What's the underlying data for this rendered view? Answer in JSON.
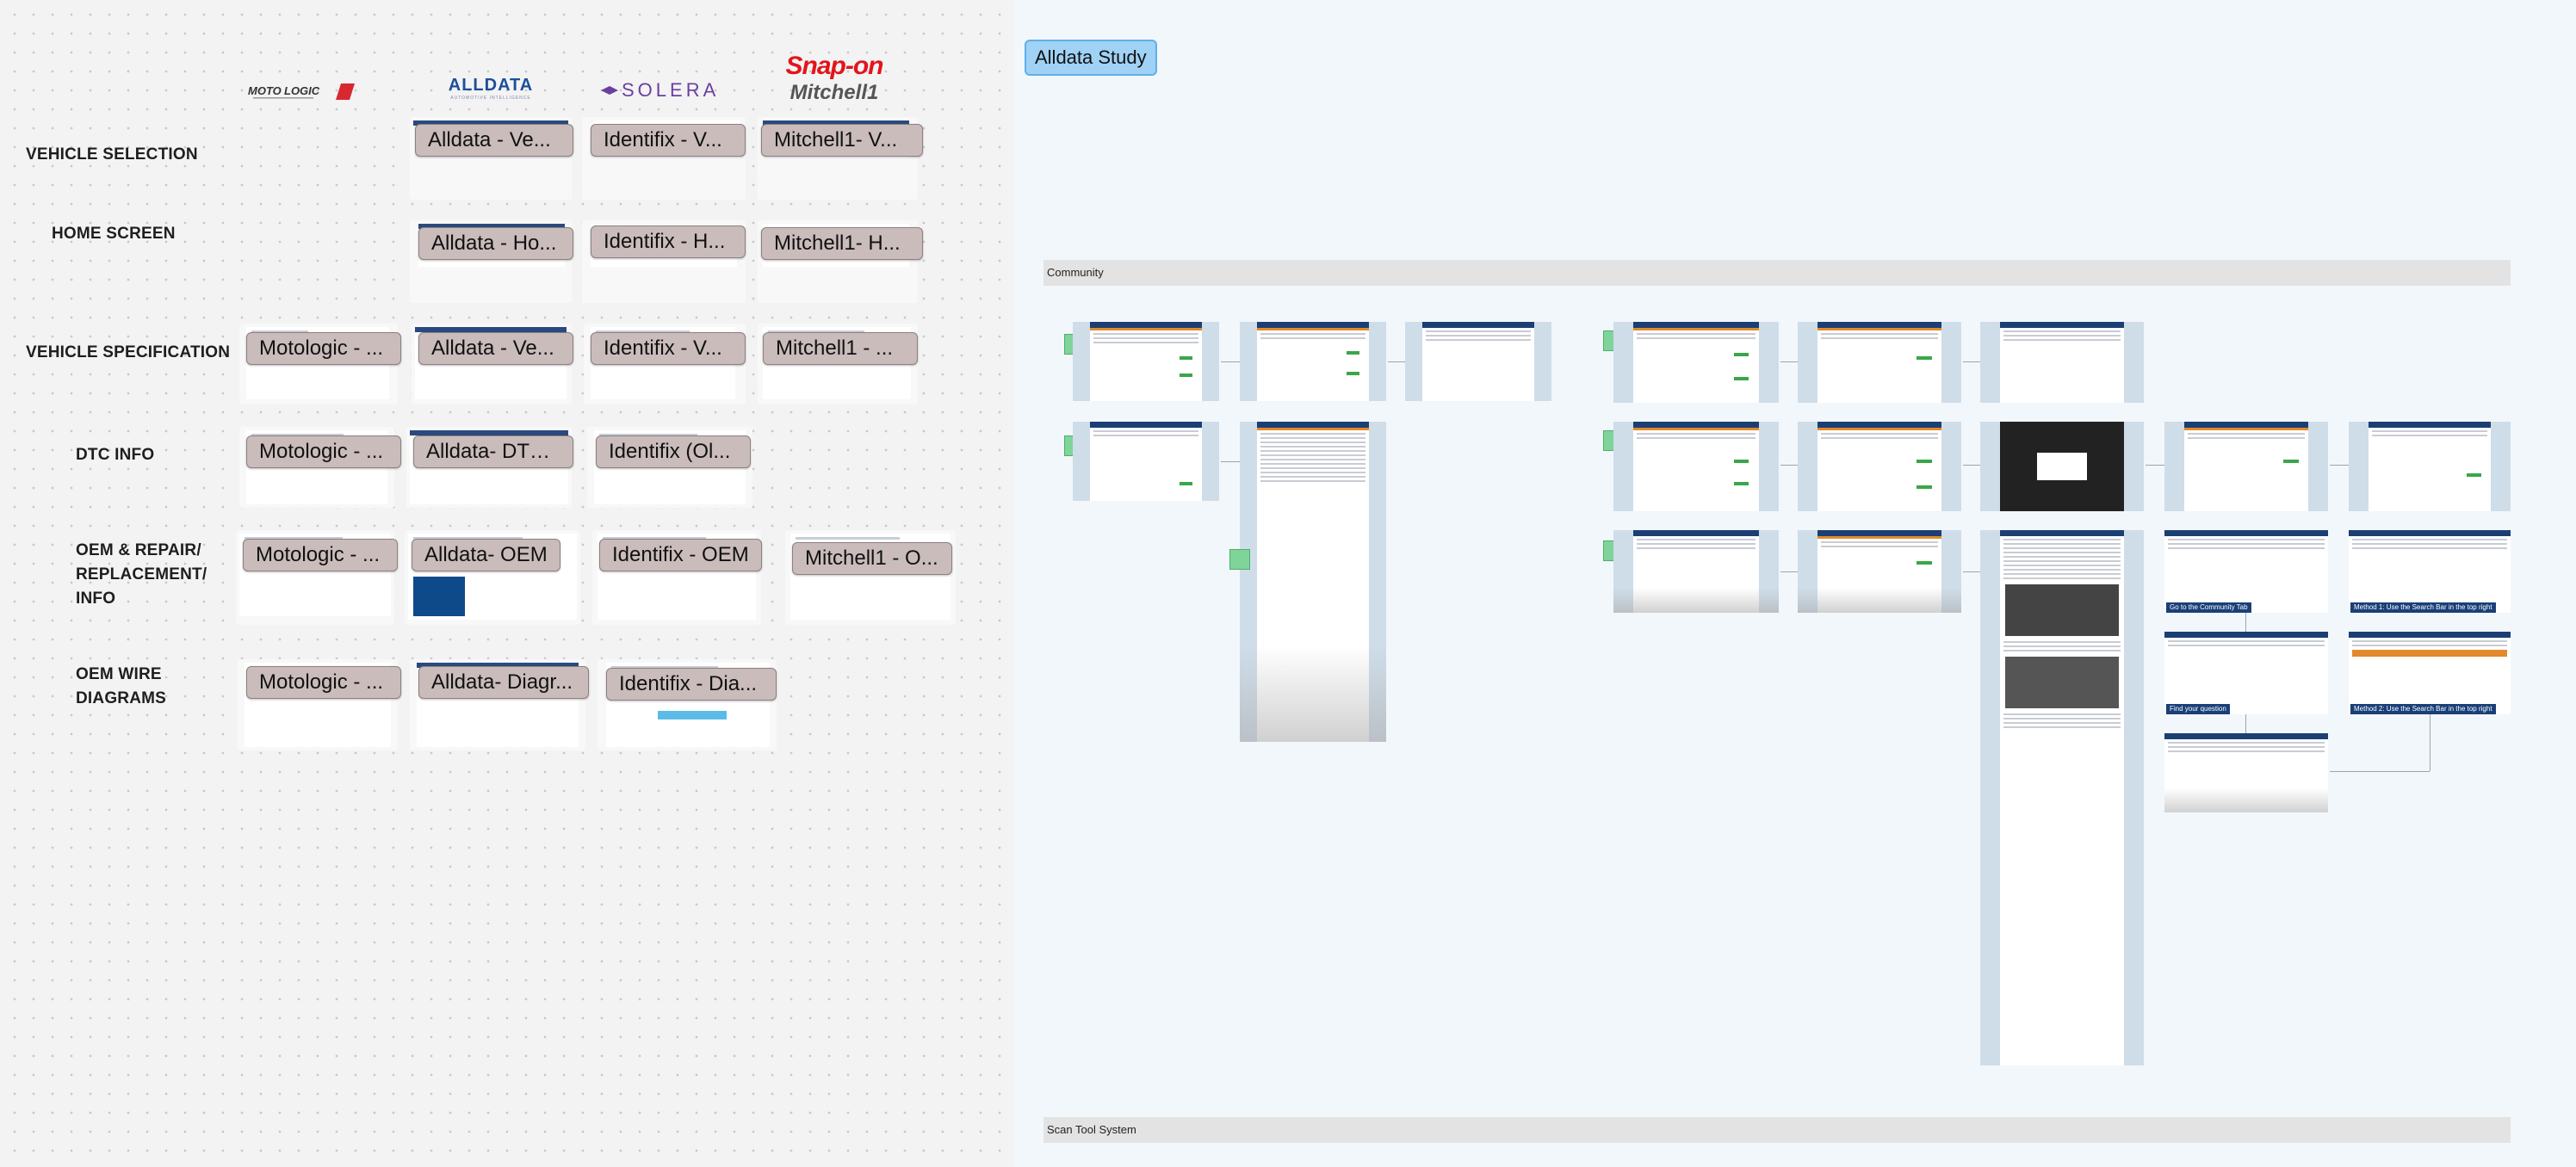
{
  "board": {
    "logos": {
      "motologic": "MOTOLOGIC",
      "alldata": "ALLDATA",
      "alldata_sub": "AUTOMOTIVE INTELLIGENCE",
      "solera": "SOLERA",
      "snapon": "Snap-on",
      "mitchell": "Mitchell1"
    },
    "rows": [
      {
        "label": "VEHICLE SELECTION"
      },
      {
        "label": "HOME SCREEN"
      },
      {
        "label": "VEHICLE SPECIFICATION"
      },
      {
        "label": "DTC INFO"
      },
      {
        "label": "OEM & REPAIR/ REPLACEMENT/ INFO"
      },
      {
        "label": "OEM WIRE DIAGRAMS"
      }
    ],
    "chips": {
      "r0": [
        "Alldata - Ve...",
        "Identifix - V...",
        "Mitchell1- V..."
      ],
      "r1": [
        "Alldata - Ho...",
        "Identifix - H...",
        "Mitchell1- H..."
      ],
      "r2": [
        "Motologic - ...",
        "Alldata - Ve...",
        "Identifix - V...",
        "Mitchell1 - ..."
      ],
      "r3": [
        "Motologic - ...",
        "Alldata- DTC...",
        "Identifix (Ol..."
      ],
      "r4": [
        "Motologic - ...",
        "Alldata- OEM",
        "Identifix - OEM",
        "Mitchell1 - O..."
      ],
      "r5": [
        "Motologic - ...",
        "Alldata- Diagr...",
        "Identifix - Dia..."
      ]
    }
  },
  "study": {
    "title": "Alldata Study",
    "sections": [
      "Community",
      "Scan Tool System"
    ],
    "captions": [
      "Go to the Community Tab",
      "Method 1: Use the Search Bar in the top right",
      "Find your question",
      "Method 2: Use the Search Bar in the top right"
    ]
  },
  "colors": {
    "canvas": "#f3f3f3",
    "section_bg": "#f2f7fb",
    "title_chip": "#9fd2f5",
    "chip": "#c9bcbb",
    "band": "#e3e3e3",
    "brand_alldata": "#1b4f9c",
    "brand_solera": "#6a3fa0",
    "brand_snapon": "#e3141b"
  }
}
